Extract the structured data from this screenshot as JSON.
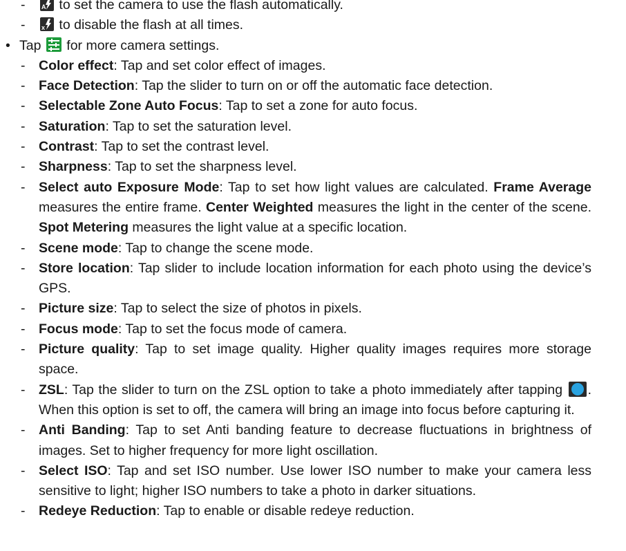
{
  "flash_items": [
    {
      "icon": "flash-auto-icon",
      "text": " to set the camera to use the flash automatically."
    },
    {
      "icon": "flash-off-icon",
      "text": " to disable the flash at all times."
    }
  ],
  "settings_bullet": {
    "prefix": "Tap ",
    "icon": "camera-settings-icon",
    "suffix": " for more camera settings."
  },
  "items": {
    "color_effect": {
      "label": "Color effect",
      "text": ": Tap and set color effect of images."
    },
    "face_detection": {
      "label": "Face Detection",
      "text": ": Tap the slider to turn on or off the automatic face detection."
    },
    "zone_af": {
      "label": "Selectable Zone Auto Focus",
      "text": ": Tap to set a zone for auto focus."
    },
    "saturation": {
      "label": "Saturation",
      "text": ": Tap to set the saturation level."
    },
    "contrast": {
      "label": "Contrast",
      "text": ": Tap to set the contrast level."
    },
    "sharpness": {
      "label": "Sharpness",
      "text": ": Tap to set the sharpness level."
    },
    "exposure": {
      "label": "Select auto Exposure Mode",
      "text1": ": Tap to set how light values are calculated. ",
      "frame_avg": "Frame Average",
      "text2": " measures the entire frame. ",
      "center_w": "Center Weighted",
      "text3": " measures the light in the center of the scene. ",
      "spot": "Spot Metering",
      "text4": " measures the light value at a specific location."
    },
    "scene_mode": {
      "label": "Scene mode",
      "text": ": Tap to change the scene mode."
    },
    "store_location": {
      "label": "Store location",
      "text": ": Tap slider to include location information for each photo using the device’s GPS."
    },
    "picture_size": {
      "label": "Picture size",
      "text": ": Tap to select the size of photos in pixels."
    },
    "focus_mode": {
      "label": "Focus mode",
      "text": ": Tap to set the focus mode of camera."
    },
    "picture_quality": {
      "label": "Picture quality",
      "text": ": Tap to set image quality. Higher quality images requires more storage space."
    },
    "zsl": {
      "label": "ZSL",
      "text1": ": Tap the slider to turn on the ZSL option to take a photo immediately after tapping ",
      "icon": "shutter-icon",
      "text2": ". When this option is set to off, the camera will bring an image into focus before capturing it."
    },
    "anti_banding": {
      "label": "Anti Banding",
      "text": ": Tap to set Anti banding feature to decrease fluctuations in brightness of images. Set to higher frequency for more light oscillation."
    },
    "select_iso": {
      "label": "Select ISO",
      "text": ": Tap and set ISO number. Use lower ISO number to make your camera less sensitive to light; higher ISO numbers to take a photo in darker situations."
    },
    "redeye": {
      "label": "Redeye Reduction",
      "text": ": Tap to enable or disable redeye reduction."
    }
  },
  "dash": "-",
  "bullet": "•"
}
